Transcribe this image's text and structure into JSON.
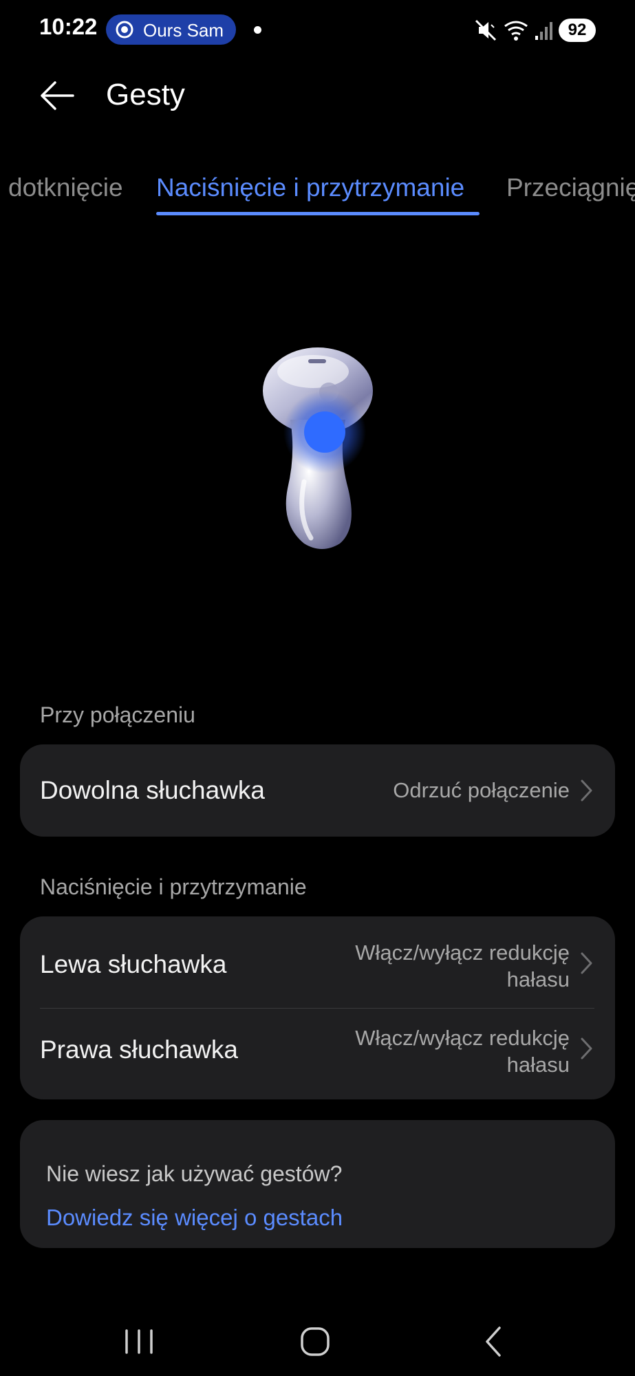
{
  "status_bar": {
    "time": "10:22",
    "pill_text": "Ours Sam",
    "battery": "92",
    "icons": [
      "vibrate-mute-icon",
      "wifi-icon",
      "signal-icon"
    ]
  },
  "header": {
    "title": "Gesty",
    "back_icon": "arrow-left-icon"
  },
  "tabs": [
    {
      "label": "dotknięcie",
      "active": false
    },
    {
      "label": "Naciśnięcie i przytrzymanie",
      "active": true
    },
    {
      "label": "Przeciągnięcie",
      "active": false
    }
  ],
  "sections": [
    {
      "label": "Przy połączeniu",
      "rows": [
        {
          "label": "Dowolna słuchawka",
          "value": "Odrzuć połączenie"
        }
      ]
    },
    {
      "label": "Naciśnięcie i przytrzymanie",
      "rows": [
        {
          "label": "Lewa słuchawka",
          "value_line1": "Włącz/wyłącz redukcję",
          "value_line2": "hałasu"
        },
        {
          "label": "Prawa słuchawka",
          "value_line1": "Włącz/wyłącz redukcję",
          "value_line2": "hałasu"
        }
      ]
    }
  ],
  "help": {
    "question": "Nie wiesz jak używać gestów?",
    "link": "Dowiedz się więcej o gestach"
  },
  "nav_bar": {
    "icons": [
      "recents-icon",
      "home-icon",
      "back-icon"
    ]
  },
  "colors": {
    "background": "#000000",
    "card": "#1f1f21",
    "accent": "#5b8cff",
    "secondary_text": "#a8a8a8"
  }
}
